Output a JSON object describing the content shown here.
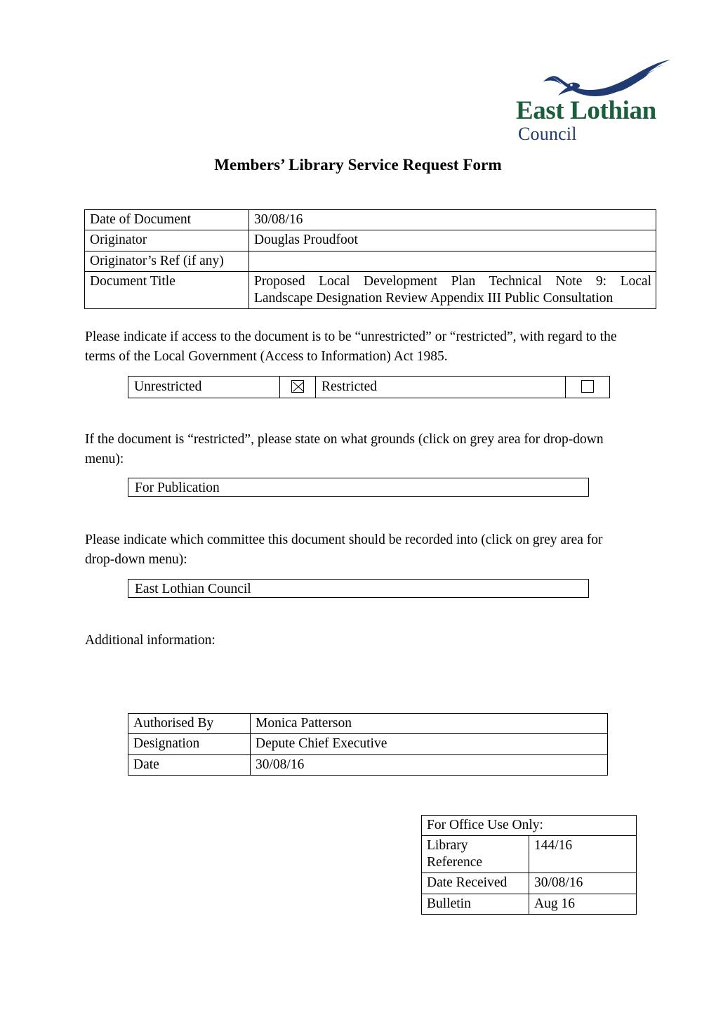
{
  "logo": {
    "bird_icon": "eagle-icon",
    "line1": "East Lothian",
    "line2": "Council",
    "green": "#1b5e3c",
    "navy": "#1f3b72"
  },
  "title": "Members’ Library Service Request Form",
  "meta_table": {
    "rows": [
      {
        "label": "Date of Document",
        "value": "30/08/16"
      },
      {
        "label": "Originator",
        "value": "Douglas Proudfoot"
      },
      {
        "label": "Originator’s Ref (if any)",
        "value": ""
      },
      {
        "label": "Document Title",
        "value_line1": "Proposed Local Development Plan Technical Note 9: Local",
        "value_line2": "Landscape Designation Review Appendix III Public Consultation"
      }
    ]
  },
  "access": {
    "paragraph": "Please indicate if access to the document is to be “unrestricted” or “restricted”, with regard to the terms of the Local Government (Access to Information) Act 1985.",
    "unrestricted_label": "Unrestricted",
    "unrestricted_checked": true,
    "restricted_label": "Restricted",
    "restricted_checked": false
  },
  "grounds": {
    "paragraph": "If the document is “restricted”, please state on what grounds (click on grey area for drop-down menu):",
    "selected_value": "For Publication"
  },
  "committee": {
    "paragraph": "Please indicate which committee this document should be recorded into (click on grey area for drop-down menu):",
    "selected_value": "East Lothian Council"
  },
  "additional": {
    "label": "Additional information:",
    "value": ""
  },
  "authorisation": {
    "rows": [
      {
        "label": "Authorised By",
        "value": "Monica Patterson"
      },
      {
        "label": "Designation",
        "value": "Depute Chief Executive"
      },
      {
        "label": "Date",
        "value": "30/08/16"
      }
    ]
  },
  "office_use": {
    "heading": "For Office Use Only:",
    "rows": [
      {
        "label": "Library Reference",
        "value": "144/16"
      },
      {
        "label": "Date Received",
        "value": "30/08/16"
      },
      {
        "label": "Bulletin",
        "value": "Aug 16"
      }
    ]
  }
}
